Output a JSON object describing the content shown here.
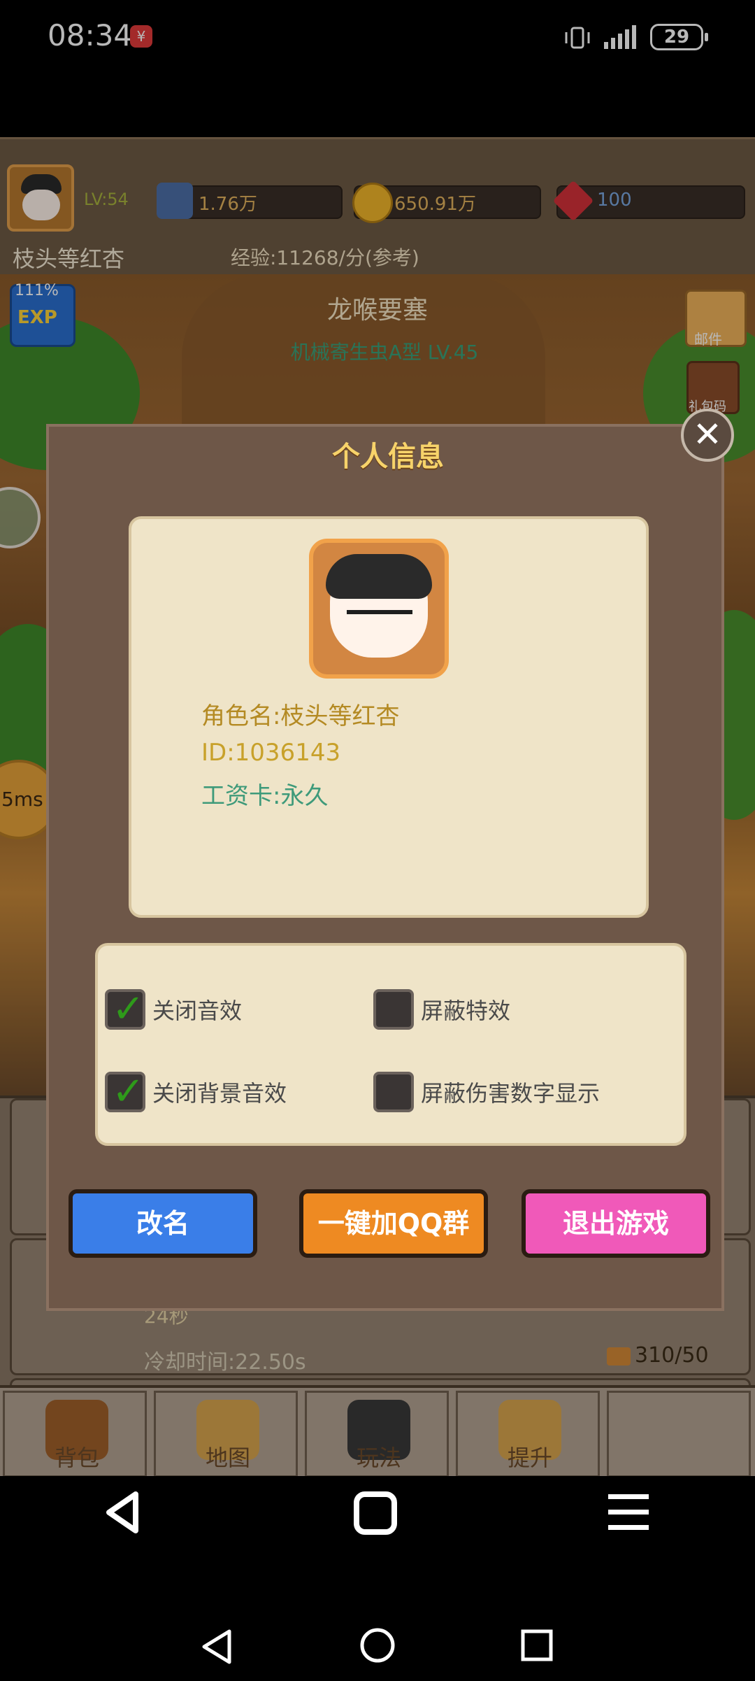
{
  "status_bar": {
    "time": "08:34",
    "notification_icon": "app-notification-icon",
    "battery": "29"
  },
  "player": {
    "level": "LV:54",
    "power": "1.76万",
    "gold": "650.91万",
    "gems": "100",
    "name": "枝头等红杏",
    "exp_rate": "经验:11268/分(参考)"
  },
  "scene": {
    "stage": "龙喉要塞",
    "boss": "机械寄生虫A型  LV.45",
    "exp_badge_pct": "111%",
    "exp_badge_text": "EXP",
    "mail_label": "邮件",
    "chest_label": "礼包码",
    "ping": "5ms"
  },
  "panel": {
    "timer": "24秒",
    "cooldown": "冷却时间:22.50s",
    "points": "310/50"
  },
  "game_nav": [
    {
      "label": "背包",
      "icon": "backpack-icon"
    },
    {
      "label": "地图",
      "icon": "map-icon"
    },
    {
      "label": "玩法",
      "icon": "gamepad-icon"
    },
    {
      "label": "提升",
      "icon": "fist-icon"
    },
    {
      "label": "",
      "icon": "empty"
    }
  ],
  "modal": {
    "title": "个人信息",
    "role_name": "角色名:枝头等红杏",
    "id": "ID:1036143",
    "wage": "工资卡:永久",
    "options": [
      {
        "label": "关闭音效",
        "checked": true
      },
      {
        "label": "屏蔽特效",
        "checked": false
      },
      {
        "label": "关闭背景音效",
        "checked": true
      },
      {
        "label": "屏蔽伤害数字显示",
        "checked": false
      }
    ],
    "buttons": {
      "rename": "改名",
      "qq": "一键加QQ群",
      "exit": "退出游戏"
    }
  },
  "colors": {
    "accent_blue": "#3a7ee8",
    "accent_orange": "#ee8a22",
    "accent_pink": "#f059b9",
    "title_gold": "#f7d36a"
  }
}
